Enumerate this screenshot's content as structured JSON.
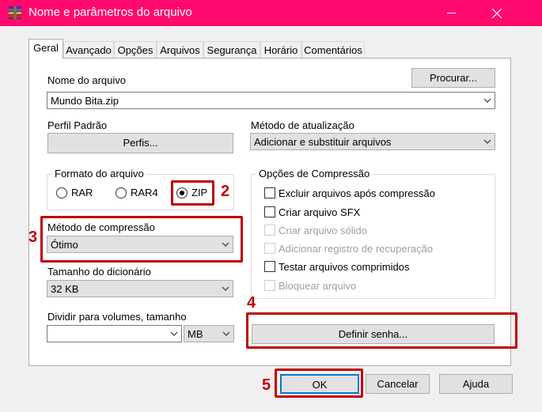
{
  "window": {
    "title": "Nome e parâmetros do arquivo"
  },
  "tabs": [
    "Geral",
    "Avançado",
    "Opções",
    "Arquivos",
    "Segurança",
    "Horário",
    "Comentários"
  ],
  "general": {
    "filename_label": "Nome do arquivo",
    "browse_button": "Procurar...",
    "filename_value": "Mundo Bita.zip",
    "profile_label": "Perfil Padrão",
    "profiles_button": "Perfis...",
    "update_label": "Método de atualização",
    "update_value": "Adicionar e substituir arquivos",
    "format_group": "Formato do arquivo",
    "formats": [
      "RAR",
      "RAR4",
      "ZIP"
    ],
    "selected_format": "ZIP",
    "compression_label": "Método de compressão",
    "compression_value": "Ótimo",
    "dict_label": "Tamanho do dicionário",
    "dict_value": "32 KB",
    "split_label": "Dividir para volumes, tamanho",
    "split_value": "",
    "split_unit": "MB",
    "options_group": "Opções de Compressão",
    "options": [
      {
        "label": "Excluir arquivos após compressão",
        "enabled": true,
        "checked": false
      },
      {
        "label": "Criar arquivo SFX",
        "enabled": true,
        "checked": false
      },
      {
        "label": "Criar arquivo sólido",
        "enabled": false,
        "checked": false
      },
      {
        "label": "Adicionar registro de recuperação",
        "enabled": false,
        "checked": false
      },
      {
        "label": "Testar arquivos comprimidos",
        "enabled": true,
        "checked": false
      },
      {
        "label": "Bloquear arquivo",
        "enabled": false,
        "checked": false
      }
    ],
    "password_button": "Definir senha..."
  },
  "footer": {
    "ok": "OK",
    "cancel": "Cancelar",
    "help": "Ajuda"
  },
  "annotations": [
    "2",
    "3",
    "4",
    "5"
  ],
  "colors": {
    "titlebar": "#ff0a6e",
    "highlight": "#c00000"
  }
}
